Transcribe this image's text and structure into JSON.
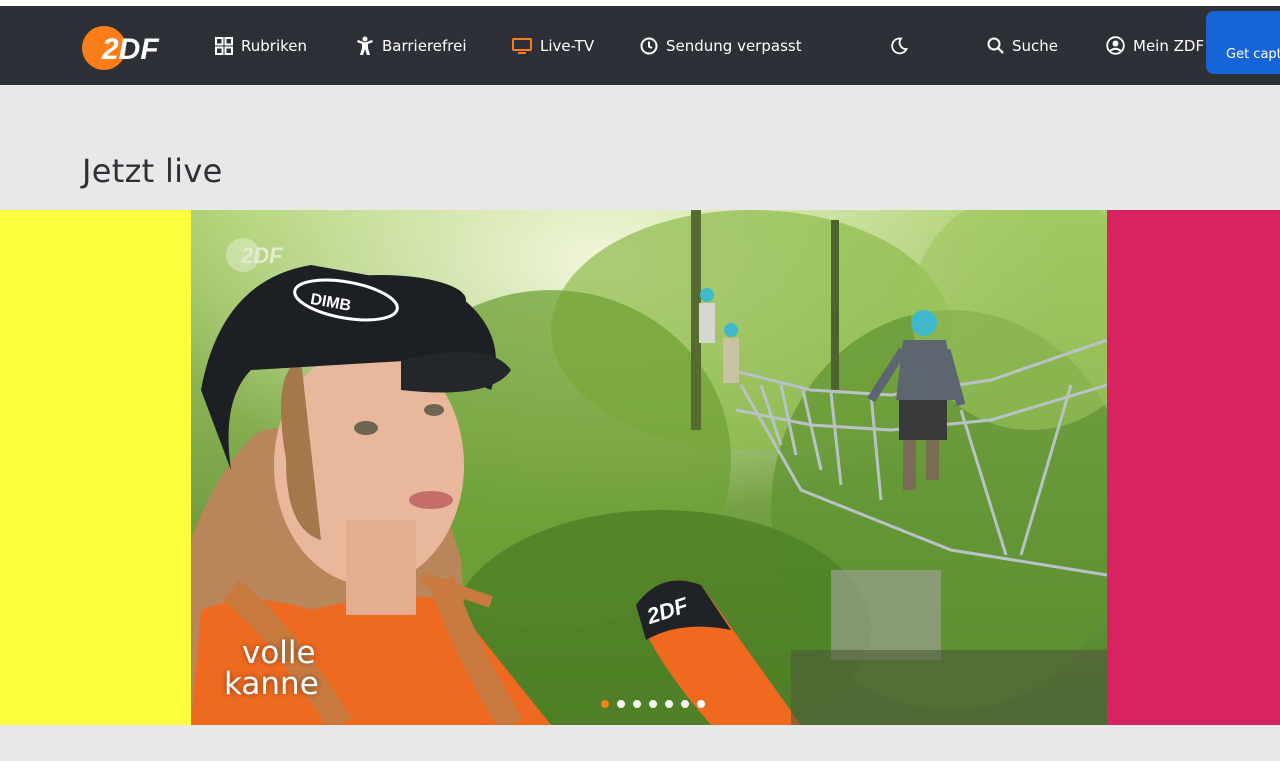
{
  "header": {
    "logo_text": "2DF",
    "nav": [
      {
        "label": "Rubriken",
        "icon": "grid-icon"
      },
      {
        "label": "Barrierefrei",
        "icon": "accessibility-icon"
      },
      {
        "label": "Live-TV",
        "icon": "tv-icon"
      },
      {
        "label": "Sendung verpasst",
        "icon": "clock-icon"
      }
    ],
    "darkmode_icon": "moon-icon",
    "search_label": "Suche",
    "account_label": "Mein ZDF",
    "cta_label": "Get capt"
  },
  "main": {
    "section_title": "Jetzt live",
    "stage": {
      "watermark": "2DF",
      "cap_text": "DIMB",
      "mic_text": "2DF",
      "show_logo_line1": "volle",
      "show_logo_line2": "kanne",
      "slide_count": 7,
      "active_slide": 1
    }
  },
  "colors": {
    "header_bg": "#2e3037",
    "accent_orange": "#fa7d19",
    "cta_blue": "#1565d8",
    "side_left": "#fcff3d",
    "side_right": "#d82361",
    "page_bg": "#e8e8e8"
  }
}
